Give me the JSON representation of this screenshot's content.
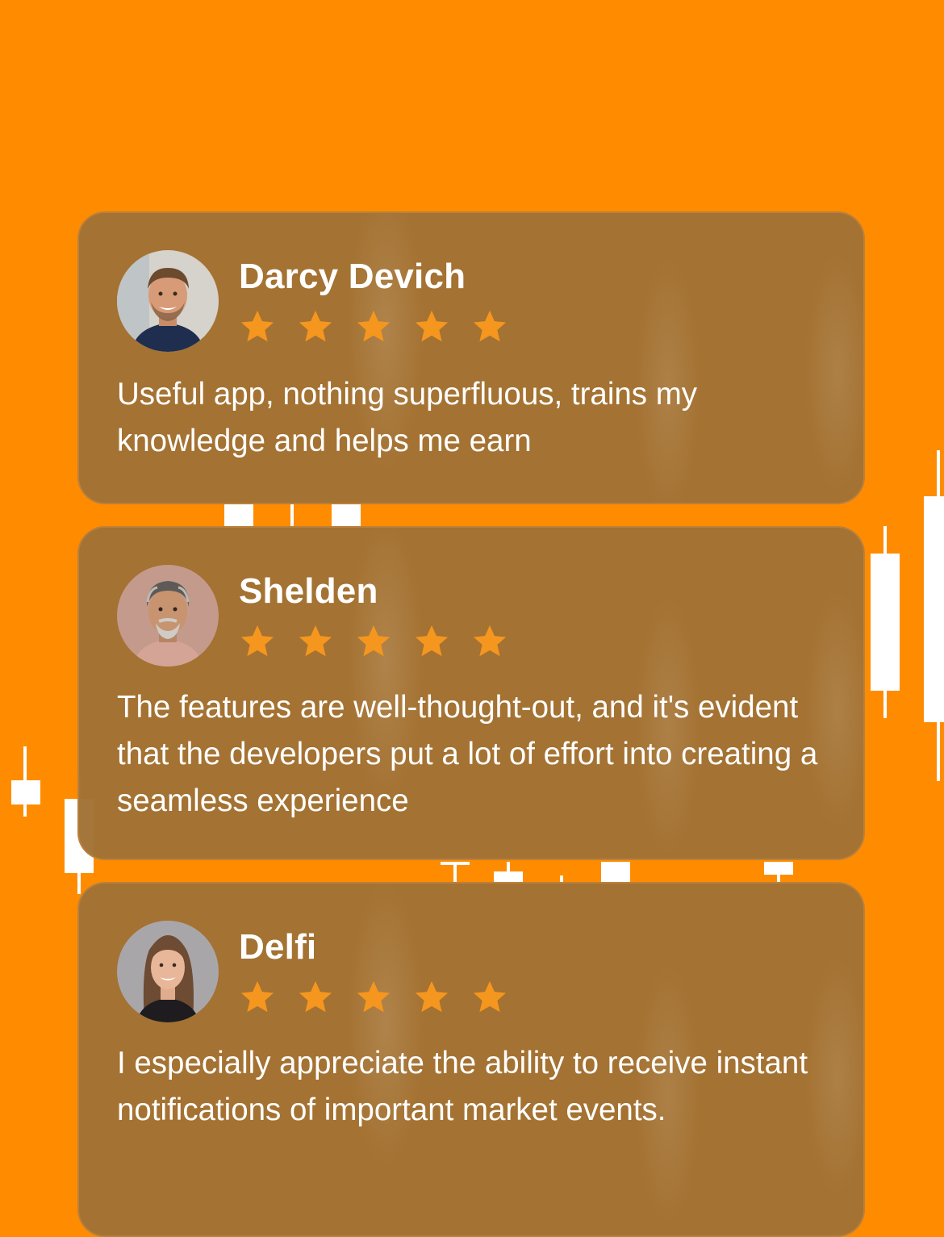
{
  "colors": {
    "background": "#FF8C00",
    "card": "#A07034",
    "star": "#F5961E",
    "text": "#FFFFFF"
  },
  "reviews": [
    {
      "name": "Darcy Devich",
      "rating": 5,
      "text": "Useful app, nothing superfluous, trains my knowledge and helps me earn"
    },
    {
      "name": "Shelden",
      "rating": 5,
      "text": "The features are well-thought-out, and it's evident that the developers put a lot of effort into creating a seamless experience"
    },
    {
      "name": "Delfi",
      "rating": 5,
      "text": "I especially appreciate the ability to receive instant notifications of important market events."
    }
  ]
}
